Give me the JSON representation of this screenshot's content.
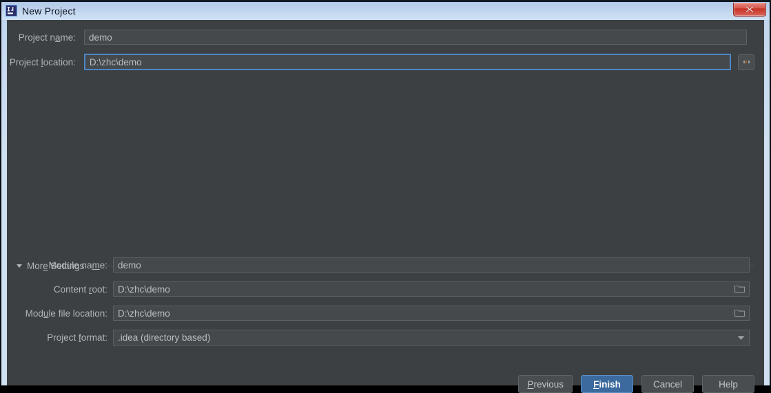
{
  "window": {
    "title": "New Project",
    "icon": "intellij-idea-icon",
    "close_label": "×",
    "accent_focus_color": "#4b87c4",
    "default_button_color": "#3c6a9e",
    "titlebar_color": "#bed3ec",
    "dialog_background": "#3c4043"
  },
  "top_fields": [
    {
      "label_pre": "Project n",
      "label_mnemonic": "a",
      "label_post": "me:",
      "value": "demo",
      "name": "project-name"
    },
    {
      "label_pre": "Project ",
      "label_mnemonic": "l",
      "label_post": "ocation:",
      "value": "D:\\zhc\\demo",
      "name": "project-location"
    }
  ],
  "browse_button": {
    "label": "...",
    "name": "browse-button"
  },
  "more_settings": {
    "label_pre": "Mor",
    "label_mnemonic": "e",
    "label_post": " Settings",
    "expanded": true,
    "triangle": "▼"
  },
  "settings_fields": [
    {
      "label_pre": "Module na",
      "label_mnemonic": "m",
      "label_post": "e:",
      "value": "demo",
      "icon": "none",
      "name": "module-name"
    },
    {
      "label_pre": "Content ",
      "label_mnemonic": "r",
      "label_post": "oot:",
      "value": "D:\\zhc\\demo",
      "icon": "folder-icon",
      "name": "content-root"
    },
    {
      "label_pre": "Mod",
      "label_mnemonic": "u",
      "label_post": "le file location:",
      "value": "D:\\zhc\\demo",
      "icon": "folder-icon",
      "name": "module-file-location"
    },
    {
      "label_pre": "Project ",
      "label_mnemonic": "f",
      "label_post": "ormat:",
      "value": ".idea (directory based)",
      "icon": "chevron-down-icon",
      "name": "project-format"
    }
  ],
  "buttons": [
    {
      "pre": "",
      "mnemonic": "P",
      "post": "revious",
      "name": "previous-button",
      "default": false
    },
    {
      "pre": "",
      "mnemonic": "F",
      "post": "inish",
      "name": "finish-button",
      "default": true
    },
    {
      "pre": "Cancel",
      "mnemonic": "",
      "post": "",
      "name": "cancel-button",
      "default": false
    },
    {
      "pre": "Help",
      "mnemonic": "",
      "post": "",
      "name": "help-button",
      "default": false
    }
  ]
}
